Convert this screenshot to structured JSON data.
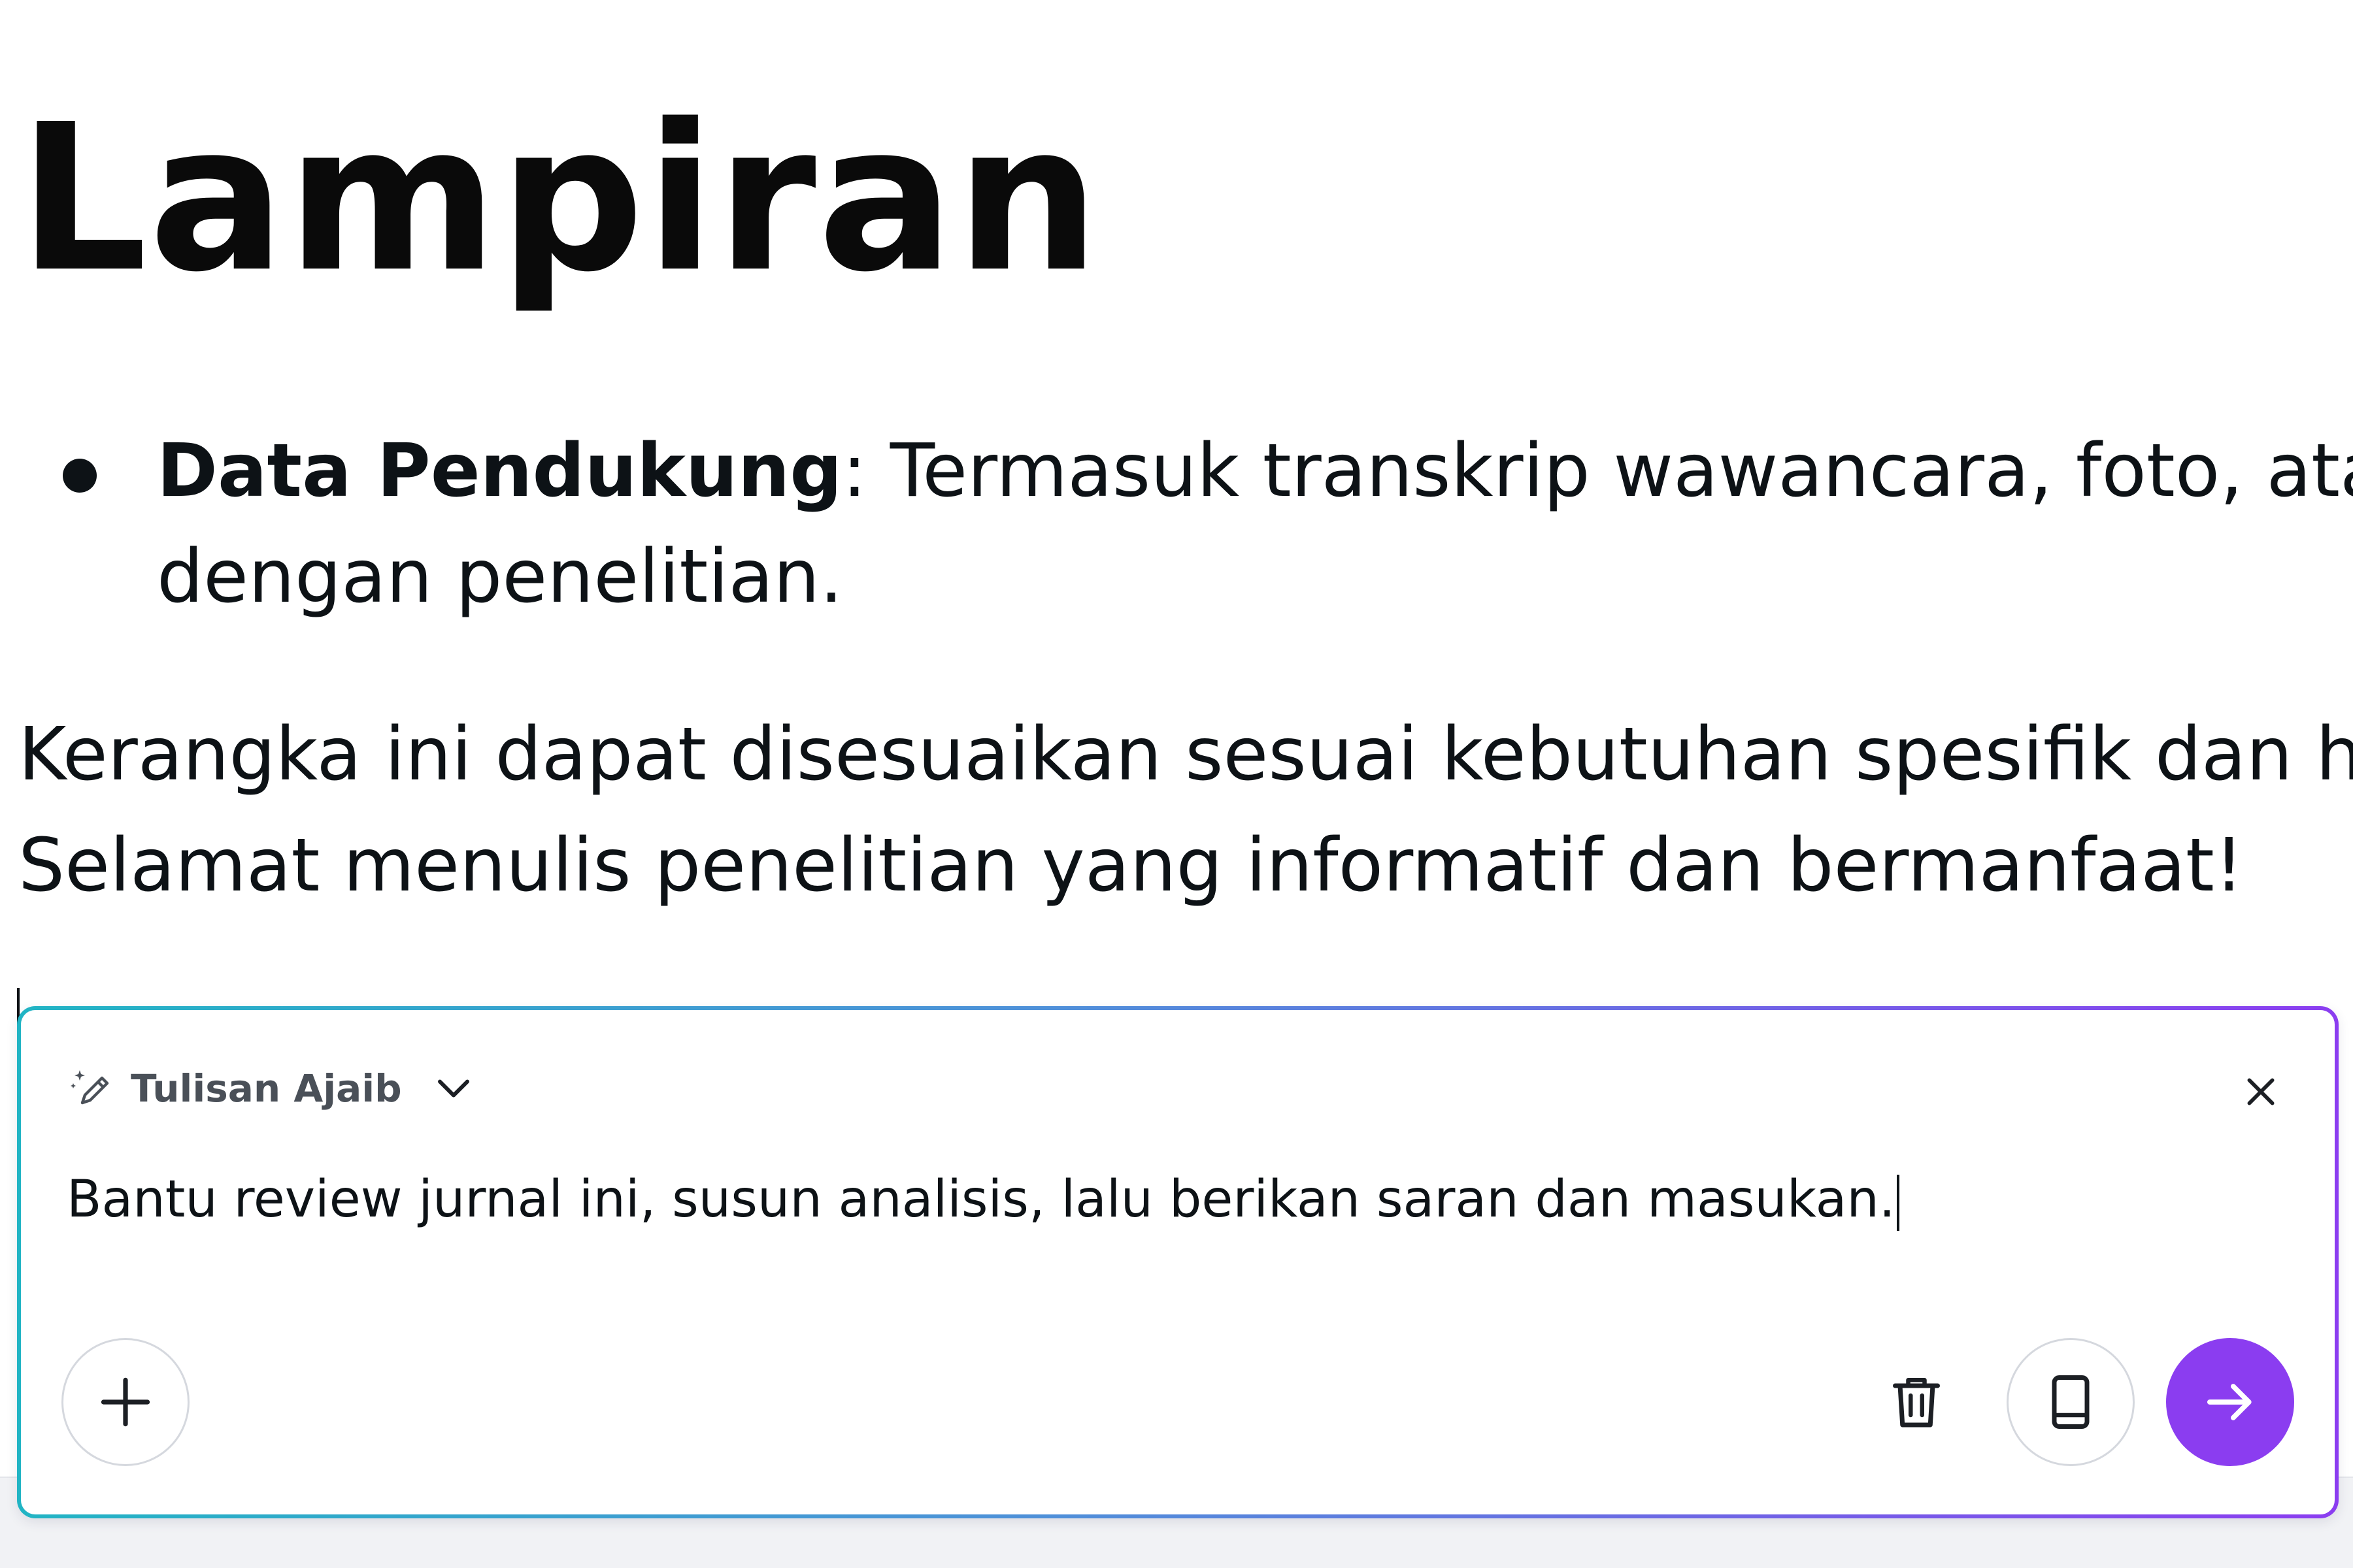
{
  "document": {
    "title": "Lampiran",
    "bullets": [
      {
        "label": "Data Pendukung",
        "line1": ": Termasuk transkrip wawancara, foto, atau d",
        "line2": "dengan penelitian."
      }
    ],
    "paragraph": {
      "line1": "Kerangka ini dapat disesuaikan sesuai kebutuhan spesifik dan has",
      "line2": "Selamat menulis penelitian yang informatif dan bermanfaat!"
    }
  },
  "magic_panel": {
    "title": "Tulisan Ajaib",
    "title_icon": "magic-pencil-icon",
    "prompt_text": "Bantu review jurnal ini, susun analisis, lalu berikan saran dan masukan.",
    "icons": {
      "dropdown": "chevron-down-icon",
      "close": "close-icon",
      "add": "plus-icon",
      "delete": "trash-icon",
      "library": "book-icon",
      "send": "arrow-right-icon"
    },
    "colors": {
      "accent": "#8b3df0",
      "gradient_start": "#21b4c4",
      "gradient_end": "#8b3df0",
      "title_text": "#4a5058"
    }
  }
}
